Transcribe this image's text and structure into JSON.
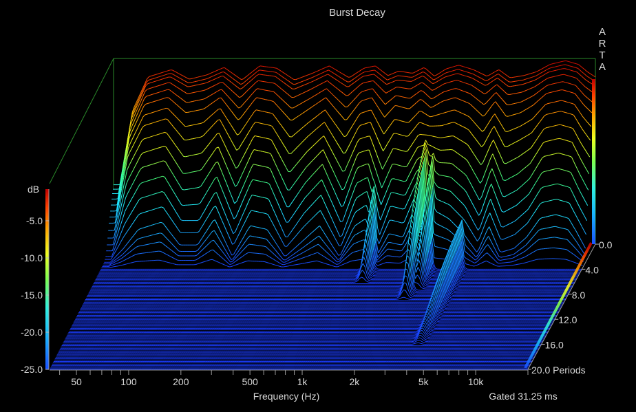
{
  "chart_data": {
    "type": "waterfall",
    "title": "Burst Decay",
    "brand": [
      "A",
      "R",
      "T",
      "A"
    ],
    "xlabel": "Frequency (Hz)",
    "x_scale": "log",
    "xlim": [
      35,
      20000
    ],
    "x_tick_labels": [
      {
        "f": 50,
        "label": "50"
      },
      {
        "f": 100,
        "label": "100"
      },
      {
        "f": 200,
        "label": "200"
      },
      {
        "f": 500,
        "label": "500"
      },
      {
        "f": 1000,
        "label": "1k"
      },
      {
        "f": 2000,
        "label": "2k"
      },
      {
        "f": 5000,
        "label": "5k"
      },
      {
        "f": 10000,
        "label": "10k"
      }
    ],
    "ylabel": "dB",
    "ylim": [
      -25,
      0
    ],
    "y_tick_labels": [
      "-5.0",
      "-10.0",
      "-15.0",
      "-20.0",
      "-25.0"
    ],
    "y_tick_values": [
      -5,
      -10,
      -15,
      -20,
      -25
    ],
    "z_label_suffix": "Periods",
    "zlim": [
      0,
      20
    ],
    "z_tick_labels": [
      "0.0",
      "4.0",
      "8.0",
      "12.0",
      "16.0",
      "20.0"
    ],
    "z_tick_values": [
      0,
      4,
      8,
      12,
      16,
      20
    ],
    "gated_text": "Gated 31.25 ms",
    "colorscale": [
      "#1a3cff",
      "#19a0ff",
      "#20f0ff",
      "#40ff80",
      "#e0ff20",
      "#ffb000",
      "#ff4a00",
      "#d00000"
    ],
    "resonances": [
      {
        "f": 1200,
        "periods": 6.0,
        "level": -14
      },
      {
        "f": 2350,
        "periods": 8.5,
        "level": -8
      },
      {
        "f": 2600,
        "periods": 7.0,
        "level": -10
      },
      {
        "f": 3900,
        "periods": 15.5,
        "level": -19
      }
    ],
    "series": [
      {
        "periods": 0,
        "dB": [
          [
            38,
            -17
          ],
          [
            45,
            -7
          ],
          [
            55,
            -2.5
          ],
          [
            75,
            -1.5
          ],
          [
            95,
            -2.8
          ],
          [
            120,
            -2.2
          ],
          [
            150,
            -1.2
          ],
          [
            190,
            -2.9
          ],
          [
            240,
            -1.0
          ],
          [
            300,
            -1.3
          ],
          [
            380,
            -2.9
          ],
          [
            480,
            -2.0
          ],
          [
            600,
            -1.0
          ],
          [
            780,
            -2.6
          ],
          [
            950,
            -1.3
          ],
          [
            1100,
            -1.0
          ],
          [
            1300,
            -2.3
          ],
          [
            1500,
            -1.7
          ],
          [
            1800,
            -2.0
          ],
          [
            2100,
            -1.2
          ],
          [
            2400,
            -2.4
          ],
          [
            2800,
            -1.4
          ],
          [
            3300,
            -0.9
          ],
          [
            4000,
            -1.5
          ],
          [
            4800,
            -2.4
          ],
          [
            5600,
            -1.5
          ],
          [
            6500,
            -2.6
          ],
          [
            7800,
            -2.3
          ],
          [
            9200,
            -1.8
          ],
          [
            11000,
            -0.8
          ],
          [
            13500,
            -0.3
          ],
          [
            16000,
            -0.8
          ],
          [
            18000,
            -1.8
          ],
          [
            20000,
            -2.5
          ]
        ]
      },
      {
        "periods": 0.5,
        "dB": [
          [
            38,
            -18
          ],
          [
            45,
            -7.9
          ],
          [
            55,
            -3.2
          ],
          [
            75,
            -2.2
          ],
          [
            95,
            -3.6
          ],
          [
            120,
            -3.1
          ],
          [
            150,
            -2.1
          ],
          [
            190,
            -4.0
          ],
          [
            240,
            -1.9
          ],
          [
            300,
            -2.2
          ],
          [
            380,
            -4.0
          ],
          [
            480,
            -3.0
          ],
          [
            600,
            -1.9
          ],
          [
            780,
            -3.7
          ],
          [
            950,
            -2.2
          ],
          [
            1100,
            -1.9
          ],
          [
            1300,
            -3.3
          ],
          [
            1500,
            -2.7
          ],
          [
            1800,
            -2.9
          ],
          [
            2100,
            -2.1
          ],
          [
            2400,
            -3.2
          ],
          [
            2800,
            -2.3
          ],
          [
            3300,
            -1.8
          ],
          [
            4000,
            -2.4
          ],
          [
            4800,
            -3.5
          ],
          [
            5600,
            -2.4
          ],
          [
            6500,
            -3.6
          ],
          [
            7800,
            -3.3
          ],
          [
            9200,
            -2.7
          ],
          [
            11000,
            -1.6
          ],
          [
            13500,
            -1.1
          ],
          [
            16000,
            -1.6
          ],
          [
            18000,
            -2.7
          ],
          [
            20000,
            -3.4
          ]
        ]
      },
      {
        "periods": 1.0,
        "dB": [
          [
            38,
            -19.5
          ],
          [
            45,
            -9.5
          ],
          [
            55,
            -5.0
          ],
          [
            75,
            -4.0
          ],
          [
            95,
            -6.0
          ],
          [
            120,
            -5.5
          ],
          [
            150,
            -4.0
          ],
          [
            190,
            -7.0
          ],
          [
            240,
            -4.0
          ],
          [
            300,
            -4.5
          ],
          [
            380,
            -7.0
          ],
          [
            480,
            -5.5
          ],
          [
            600,
            -4.0
          ],
          [
            780,
            -7.0
          ],
          [
            950,
            -4.5
          ],
          [
            1100,
            -4.0
          ],
          [
            1300,
            -6.5
          ],
          [
            1500,
            -5.0
          ],
          [
            1800,
            -5.5
          ],
          [
            2100,
            -4.2
          ],
          [
            2400,
            -5.5
          ],
          [
            2800,
            -4.5
          ],
          [
            3300,
            -4.0
          ],
          [
            4000,
            -4.8
          ],
          [
            4800,
            -6.5
          ],
          [
            5600,
            -4.5
          ],
          [
            6500,
            -6.5
          ],
          [
            7800,
            -6.0
          ],
          [
            9200,
            -5.0
          ],
          [
            11000,
            -3.5
          ],
          [
            13500,
            -3.0
          ],
          [
            16000,
            -3.5
          ],
          [
            18000,
            -5.0
          ],
          [
            20000,
            -6.0
          ]
        ]
      },
      {
        "periods": 1.5,
        "dB": [
          [
            38,
            -21
          ],
          [
            45,
            -12
          ],
          [
            55,
            -8
          ],
          [
            75,
            -7
          ],
          [
            95,
            -10
          ],
          [
            120,
            -9.5
          ],
          [
            150,
            -7
          ],
          [
            190,
            -11.5
          ],
          [
            240,
            -7.5
          ],
          [
            300,
            -8
          ],
          [
            380,
            -12
          ],
          [
            480,
            -9.5
          ],
          [
            600,
            -7.5
          ],
          [
            780,
            -12
          ],
          [
            950,
            -8
          ],
          [
            1100,
            -7.5
          ],
          [
            1300,
            -11.5
          ],
          [
            1500,
            -9
          ],
          [
            1800,
            -9.5
          ],
          [
            2100,
            -7.5
          ],
          [
            2400,
            -8
          ],
          [
            2800,
            -8
          ],
          [
            3300,
            -7.5
          ],
          [
            4000,
            -8.5
          ],
          [
            4800,
            -11
          ],
          [
            5600,
            -8
          ],
          [
            6500,
            -11
          ],
          [
            7800,
            -10
          ],
          [
            9200,
            -9
          ],
          [
            11000,
            -6.5
          ],
          [
            13500,
            -6
          ],
          [
            16000,
            -6.5
          ],
          [
            18000,
            -8.5
          ],
          [
            20000,
            -10
          ]
        ]
      },
      {
        "periods": 2.0,
        "dB": [
          [
            38,
            -23
          ],
          [
            45,
            -16
          ],
          [
            55,
            -12
          ],
          [
            75,
            -11
          ],
          [
            95,
            -15
          ],
          [
            120,
            -14.5
          ],
          [
            150,
            -11
          ],
          [
            190,
            -17
          ],
          [
            240,
            -11.5
          ],
          [
            300,
            -12
          ],
          [
            380,
            -17.5
          ],
          [
            480,
            -14
          ],
          [
            600,
            -11.5
          ],
          [
            780,
            -17.5
          ],
          [
            950,
            -12
          ],
          [
            1100,
            -11.5
          ],
          [
            1300,
            -17
          ],
          [
            1500,
            -13.5
          ],
          [
            1800,
            -14
          ],
          [
            2100,
            -11
          ],
          [
            2400,
            -10.5
          ],
          [
            2800,
            -11.5
          ],
          [
            3300,
            -11.5
          ],
          [
            4000,
            -13
          ],
          [
            4800,
            -16.5
          ],
          [
            5600,
            -12
          ],
          [
            6500,
            -16
          ],
          [
            7800,
            -15
          ],
          [
            9200,
            -13.5
          ],
          [
            11000,
            -10.5
          ],
          [
            13500,
            -10
          ],
          [
            16000,
            -10.5
          ],
          [
            18000,
            -13
          ],
          [
            20000,
            -15
          ]
        ]
      },
      {
        "periods": 2.5,
        "dB": [
          [
            38,
            -24.5
          ],
          [
            45,
            -20
          ],
          [
            55,
            -16.5
          ],
          [
            75,
            -15.5
          ],
          [
            95,
            -19.5
          ],
          [
            120,
            -19.5
          ],
          [
            150,
            -15.5
          ],
          [
            190,
            -21.5
          ],
          [
            240,
            -16
          ],
          [
            300,
            -16.5
          ],
          [
            380,
            -22
          ],
          [
            480,
            -18.5
          ],
          [
            600,
            -16
          ],
          [
            780,
            -22
          ],
          [
            950,
            -16.5
          ],
          [
            1100,
            -15.5
          ],
          [
            1300,
            -21.5
          ],
          [
            1500,
            -17.5
          ],
          [
            1800,
            -18
          ],
          [
            2100,
            -14.5
          ],
          [
            2400,
            -13
          ],
          [
            2800,
            -15
          ],
          [
            3300,
            -15.5
          ],
          [
            4000,
            -17.5
          ],
          [
            4800,
            -21
          ],
          [
            5600,
            -16.5
          ],
          [
            6500,
            -20.5
          ],
          [
            7800,
            -19.5
          ],
          [
            9200,
            -18
          ],
          [
            11000,
            -15
          ],
          [
            13500,
            -14.5
          ],
          [
            16000,
            -15
          ],
          [
            18000,
            -17.5
          ],
          [
            20000,
            -19.5
          ]
        ]
      },
      {
        "periods": 3.0,
        "dB": [
          [
            38,
            -25
          ],
          [
            45,
            -23.5
          ],
          [
            55,
            -21
          ],
          [
            75,
            -20
          ],
          [
            95,
            -23
          ],
          [
            120,
            -23
          ],
          [
            150,
            -19.5
          ],
          [
            190,
            -24.5
          ],
          [
            240,
            -20.5
          ],
          [
            300,
            -21
          ],
          [
            380,
            -24.5
          ],
          [
            480,
            -22.5
          ],
          [
            600,
            -20.5
          ],
          [
            780,
            -24.5
          ],
          [
            950,
            -20.5
          ],
          [
            1100,
            -19.5
          ],
          [
            1300,
            -24
          ],
          [
            1500,
            -21.5
          ],
          [
            1800,
            -22
          ],
          [
            2100,
            -18
          ],
          [
            2400,
            -16
          ],
          [
            2800,
            -18.5
          ],
          [
            3300,
            -19.5
          ],
          [
            4000,
            -21.5
          ],
          [
            4800,
            -24
          ],
          [
            5600,
            -20.5
          ],
          [
            6500,
            -24
          ],
          [
            7800,
            -23.5
          ],
          [
            9200,
            -22
          ],
          [
            11000,
            -19.5
          ],
          [
            13500,
            -19
          ],
          [
            16000,
            -19.5
          ],
          [
            18000,
            -21.5
          ],
          [
            20000,
            -23.5
          ]
        ]
      },
      {
        "periods": 4.0,
        "dB": [
          [
            38,
            -25
          ],
          [
            20000,
            -25
          ]
        ]
      },
      {
        "periods": 20.0,
        "dB": [
          [
            38,
            -25
          ],
          [
            20000,
            -25
          ]
        ]
      }
    ]
  }
}
